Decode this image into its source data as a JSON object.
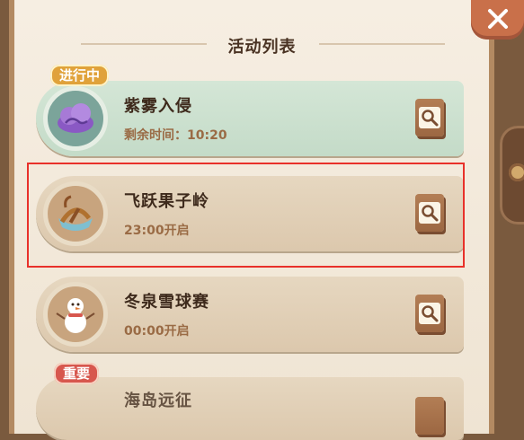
{
  "title": "活动列表",
  "colors": {
    "highlight": "#e8312a",
    "active_card": "#c4dbc8",
    "normal_card": "#dcc8ad",
    "badge_active": "#e0a23a",
    "badge_important": "#d7574e"
  },
  "events": [
    {
      "name": "紫雾入侵",
      "time": "剩余时间：10:20",
      "badge": "进行中",
      "icon": "purple-cloud-icon",
      "state": "active"
    },
    {
      "name": "飞跃果子岭",
      "time": "23:00开启",
      "badge": "",
      "icon": "boat-icon",
      "state": "normal"
    },
    {
      "name": "冬泉雪球赛",
      "time": "00:00开启",
      "badge": "",
      "icon": "snowman-icon",
      "state": "normal"
    },
    {
      "name": "海岛远征",
      "time": "",
      "badge": "重要",
      "icon": "",
      "state": "normal"
    }
  ],
  "controls": {
    "close": "close-icon",
    "detail": "magnifier-icon"
  }
}
